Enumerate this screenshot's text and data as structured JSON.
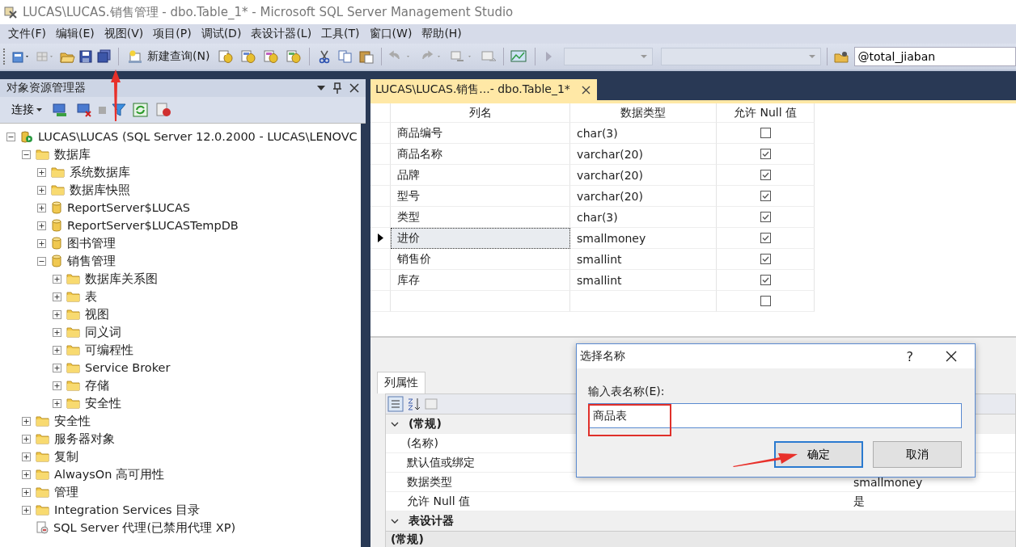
{
  "window": {
    "title": "LUCAS\\LUCAS.销售管理 - dbo.Table_1* - Microsoft SQL Server Management Studio"
  },
  "menu": [
    "文件(F)",
    "编辑(E)",
    "视图(V)",
    "项目(P)",
    "调试(D)",
    "表设计器(L)",
    "工具(T)",
    "窗口(W)",
    "帮助(H)"
  ],
  "toolbar": {
    "new_query": "新建查询(N)",
    "search_value": "@total_jiaban"
  },
  "object_explorer": {
    "title": "对象资源管理器",
    "connect": "连接",
    "tree": [
      {
        "label": "LUCAS\\LUCAS (SQL Server 12.0.2000 - LUCAS\\LENOVC",
        "kind": "server",
        "expanded": true,
        "children": [
          {
            "label": "数据库",
            "kind": "folder",
            "expanded": true,
            "children": [
              {
                "label": "系统数据库",
                "kind": "folder",
                "expanded": false
              },
              {
                "label": "数据库快照",
                "kind": "folder",
                "expanded": false
              },
              {
                "label": "ReportServer$LUCAS",
                "kind": "database",
                "expanded": false
              },
              {
                "label": "ReportServer$LUCASTempDB",
                "kind": "database",
                "expanded": false
              },
              {
                "label": "图书管理",
                "kind": "database",
                "expanded": false
              },
              {
                "label": "销售管理",
                "kind": "database",
                "expanded": true,
                "children": [
                  {
                    "label": "数据库关系图",
                    "kind": "folder",
                    "expanded": false
                  },
                  {
                    "label": "表",
                    "kind": "folder",
                    "expanded": false
                  },
                  {
                    "label": "视图",
                    "kind": "folder",
                    "expanded": false
                  },
                  {
                    "label": "同义词",
                    "kind": "folder",
                    "expanded": false
                  },
                  {
                    "label": "可编程性",
                    "kind": "folder",
                    "expanded": false
                  },
                  {
                    "label": "Service Broker",
                    "kind": "folder",
                    "expanded": false
                  },
                  {
                    "label": "存储",
                    "kind": "folder",
                    "expanded": false
                  },
                  {
                    "label": "安全性",
                    "kind": "folder",
                    "expanded": false
                  }
                ]
              }
            ]
          },
          {
            "label": "安全性",
            "kind": "folder",
            "expanded": false
          },
          {
            "label": "服务器对象",
            "kind": "folder",
            "expanded": false
          },
          {
            "label": "复制",
            "kind": "folder",
            "expanded": false
          },
          {
            "label": "AlwaysOn 高可用性",
            "kind": "folder",
            "expanded": false
          },
          {
            "label": "管理",
            "kind": "folder",
            "expanded": false
          },
          {
            "label": "Integration Services 目录",
            "kind": "folder",
            "expanded": false
          },
          {
            "label": "SQL Server 代理(已禁用代理 XP)",
            "kind": "agent"
          }
        ]
      }
    ]
  },
  "document_tab": {
    "label": "LUCAS\\LUCAS.销售...- dbo.Table_1*",
    "selected": true
  },
  "table": {
    "columns": [
      "列名",
      "数据类型",
      "允许 Null 值"
    ],
    "rows": [
      {
        "name": "商品编号",
        "type": "char(3)",
        "allow_null": false,
        "selected": false
      },
      {
        "name": "商品名称",
        "type": "varchar(20)",
        "allow_null": true,
        "selected": false
      },
      {
        "name": "品牌",
        "type": "varchar(20)",
        "allow_null": true,
        "selected": false
      },
      {
        "name": "型号",
        "type": "varchar(20)",
        "allow_null": true,
        "selected": false
      },
      {
        "name": "类型",
        "type": "char(3)",
        "allow_null": true,
        "selected": false
      },
      {
        "name": "进价",
        "type": "smallmoney",
        "allow_null": true,
        "selected": true
      },
      {
        "name": "销售价",
        "type": "smallint",
        "allow_null": true,
        "selected": false
      },
      {
        "name": "库存",
        "type": "smallint",
        "allow_null": true,
        "selected": false
      }
    ],
    "new_row": {
      "allow_null": false
    }
  },
  "properties": {
    "tab": "列属性",
    "groups": [
      {
        "label": "(常规)",
        "expanded": true,
        "rows": [
          {
            "label": "(名称)"
          },
          {
            "label": "默认值或绑定"
          },
          {
            "label": "数据类型",
            "value": "smallmoney"
          },
          {
            "label": "允许 Null 值",
            "value": "是"
          }
        ]
      },
      {
        "label": "表设计器",
        "expanded": true
      }
    ],
    "trailing_group": "(常规)"
  },
  "dialog": {
    "title": "选择名称",
    "help": "?",
    "label": "输入表名称(E):",
    "value": "商品表",
    "buttons": [
      {
        "label": "确定",
        "default": true
      },
      {
        "label": "取消",
        "default": false
      }
    ]
  }
}
